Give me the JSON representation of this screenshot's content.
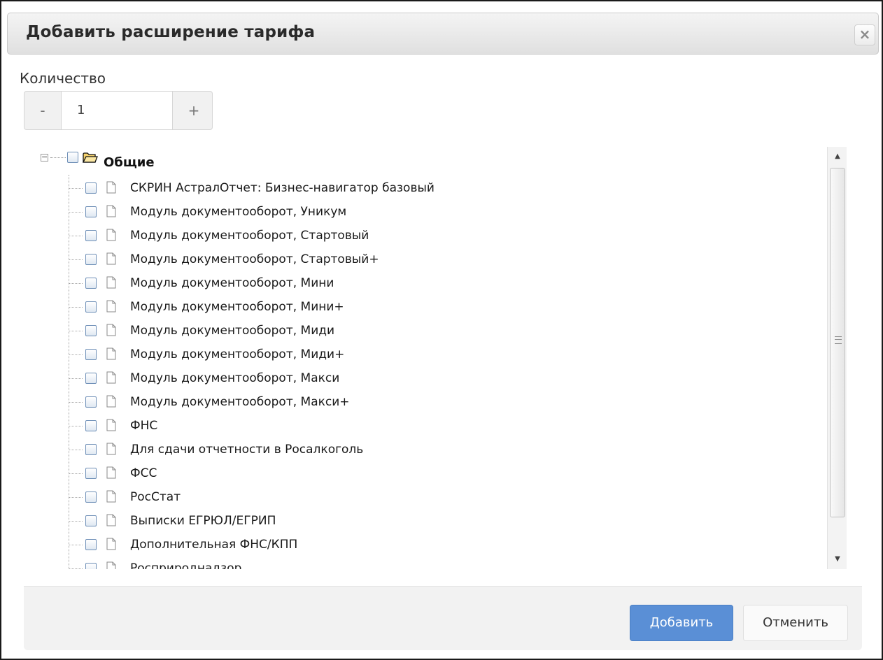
{
  "dialog": {
    "title": "Добавить расширение тарифа",
    "close_symbol": "×"
  },
  "quantity": {
    "label": "Количество",
    "minus": "-",
    "value": "1",
    "plus": "+"
  },
  "tree": {
    "root": {
      "label": "Общие",
      "expanded_symbol": "−",
      "icon": "folder-open-icon"
    },
    "items": [
      {
        "label": "СКРИН АстралОтчет: Бизнес-навигатор базовый"
      },
      {
        "label": "Модуль документооборот, Уникум"
      },
      {
        "label": "Модуль документооборот, Стартовый"
      },
      {
        "label": "Модуль документооборот, Стартовый+"
      },
      {
        "label": "Модуль документооборот, Мини"
      },
      {
        "label": "Модуль документооборот, Мини+"
      },
      {
        "label": "Модуль документооборот, Миди"
      },
      {
        "label": "Модуль документооборот, Миди+"
      },
      {
        "label": "Модуль документооборот, Макси"
      },
      {
        "label": "Модуль документооборот, Макси+"
      },
      {
        "label": "ФНС"
      },
      {
        "label": "Для сдачи отчетности в Росалкоголь"
      },
      {
        "label": "ФСС"
      },
      {
        "label": "РосСтат"
      },
      {
        "label": "Выписки ЕГРЮЛ/ЕГРИП"
      },
      {
        "label": "Дополнительная ФНС/КПП"
      },
      {
        "label": "Росприроднадзор"
      }
    ]
  },
  "footer": {
    "add_label": "Добавить",
    "cancel_label": "Отменить"
  },
  "colors": {
    "primary_button": "#5a8fd6",
    "checkbox_border": "#6e8fb7"
  }
}
